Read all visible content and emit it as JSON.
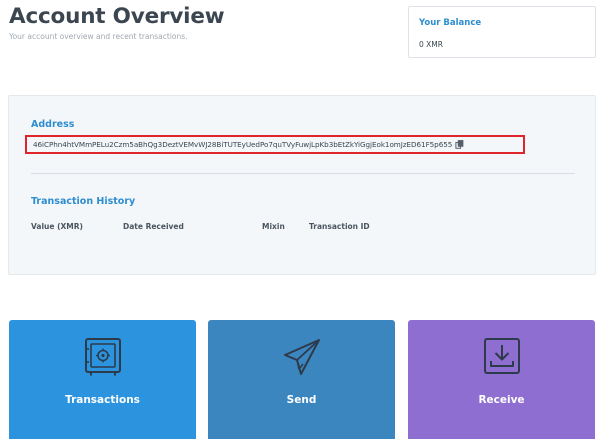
{
  "header": {
    "title": "Account Overview",
    "subtitle": "Your account overview and recent transactions."
  },
  "balance": {
    "label": "Your Balance",
    "value": "0 XMR"
  },
  "address": {
    "label": "Address",
    "value": "46iCPhn4htVMmPELu2Czm5aBhQg3DeztVEMvWJ28BiTUTEyUedPo7quTVyFuwjLpKb3bEtZkYiGgjEok1omJzED61F5p655",
    "copy_icon": "copy-icon"
  },
  "history": {
    "label": "Transaction History",
    "columns": [
      "Value (XMR)",
      "Date Received",
      "Mixin",
      "Transaction ID"
    ],
    "rows": []
  },
  "actions": [
    {
      "label": "Transactions",
      "icon": "safe-icon",
      "color": "#2c94df"
    },
    {
      "label": "Send",
      "icon": "paper-plane-icon",
      "color": "#3c86bf"
    },
    {
      "label": "Receive",
      "icon": "download-tray-icon",
      "color": "#8e6ed1"
    }
  ],
  "colors": {
    "accent": "#2d8dcf",
    "highlight_border": "#e0242c",
    "panel_bg": "#f4f7fa",
    "icon_stroke": "#2d3a4a"
  }
}
